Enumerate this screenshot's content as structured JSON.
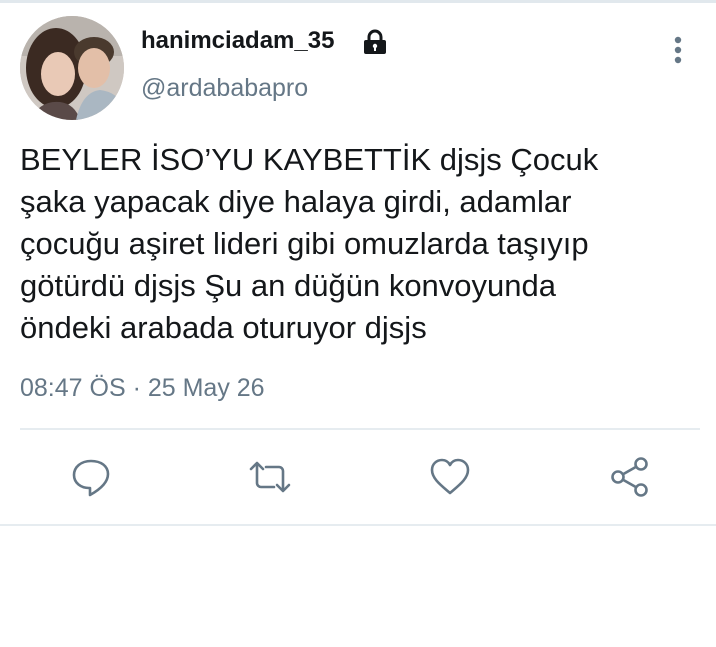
{
  "tweet": {
    "display_name": "hanimciadam_35",
    "username": "@ardababapro",
    "text": "BEYLER İSO’YU KAYBETTİK djsjs Çocuk\nşaka yapacak diye halaya girdi, adamlar\nçocuğu aşiret lideri gibi omuzlarda taşıyıp\ngötürdü djsjs Şu an düğün konvoyunda\nöndeki arabada oturuyor djsjs",
    "timestamp": "08:47 ÖS · 25 May 26",
    "protected_icon": "lock-icon",
    "menu_icon": "more-vertical-icon"
  },
  "actions": [
    {
      "name": "reply",
      "icon": "reply-icon"
    },
    {
      "name": "retweet",
      "icon": "retweet-icon"
    },
    {
      "name": "like",
      "icon": "heart-icon"
    },
    {
      "name": "share",
      "icon": "share-icon"
    }
  ],
  "colors": {
    "text_primary": "#14171a",
    "text_secondary": "#657786",
    "icon": "#657786",
    "divider": "#e6ecf0"
  }
}
